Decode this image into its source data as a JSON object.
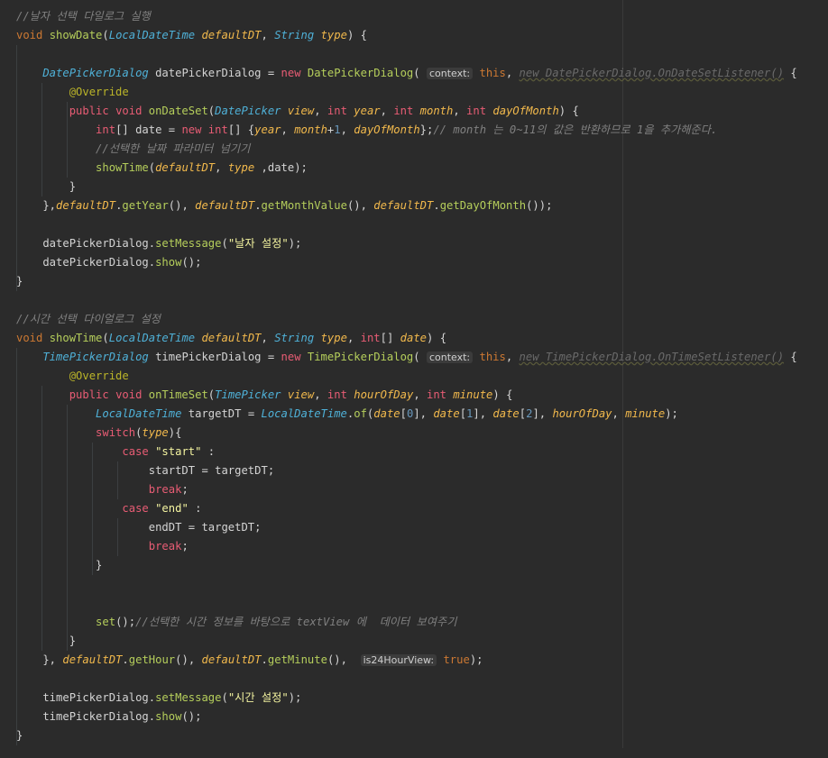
{
  "colors": {
    "background": "#2b2b2b",
    "keyword": "#cc7832",
    "type": "#4fb1d8",
    "function": "#b5ce5b",
    "parameter": "#f2b94c",
    "string": "#f4f4a0",
    "comment": "#808080"
  },
  "lines": [
    [
      [
        "com",
        "//날자 선택 다일로그 실행"
      ]
    ],
    [
      [
        "kw",
        "void "
      ],
      [
        "fn",
        "showDate"
      ],
      [
        "pl",
        "("
      ],
      [
        "typ",
        "LocalDateTime "
      ],
      [
        "param",
        "defaultDT"
      ],
      [
        "pl",
        ", "
      ],
      [
        "typ",
        "String "
      ],
      [
        "param",
        "type"
      ],
      [
        "pl",
        ") {"
      ]
    ],
    [],
    [
      [
        "typ",
        "    DatePickerDialog "
      ],
      [
        "pl",
        "datePickerDialog = "
      ],
      [
        "kw2",
        "new "
      ],
      [
        "fn",
        "DatePickerDialog"
      ],
      [
        "pl",
        "( "
      ],
      [
        "hint",
        "context:"
      ],
      [
        "pl",
        " "
      ],
      [
        "kw",
        "this"
      ],
      [
        "pl",
        ", "
      ],
      [
        "dim",
        "new DatePickerDialog.OnDateSetListener()"
      ],
      [
        "pl",
        " {"
      ]
    ],
    [
      [
        "ann",
        "        @Override"
      ]
    ],
    [
      [
        "kw2",
        "        public "
      ],
      [
        "kw2",
        "void "
      ],
      [
        "fn",
        "onDateSet"
      ],
      [
        "pl",
        "("
      ],
      [
        "typ",
        "DatePicker "
      ],
      [
        "param",
        "view"
      ],
      [
        "pl",
        ", "
      ],
      [
        "kw2",
        "int "
      ],
      [
        "param",
        "year"
      ],
      [
        "pl",
        ", "
      ],
      [
        "kw2",
        "int "
      ],
      [
        "param",
        "month"
      ],
      [
        "pl",
        ", "
      ],
      [
        "kw2",
        "int "
      ],
      [
        "param",
        "dayOfMonth"
      ],
      [
        "pl",
        ") {"
      ]
    ],
    [
      [
        "kw2",
        "            int"
      ],
      [
        "pl",
        "[] date = "
      ],
      [
        "kw2",
        "new "
      ],
      [
        "kw2",
        "int"
      ],
      [
        "pl",
        "[] {"
      ],
      [
        "param",
        "year"
      ],
      [
        "pl",
        ", "
      ],
      [
        "param",
        "month"
      ],
      [
        "pl",
        "+"
      ],
      [
        "num",
        "1"
      ],
      [
        "pl",
        ", "
      ],
      [
        "param",
        "dayOfMonth"
      ],
      [
        "pl",
        "};"
      ],
      [
        "com",
        "// month 는 0~11의 값은 반환하므로 1을 추가해준다."
      ]
    ],
    [
      [
        "com",
        "            //선택한 날짜 파라미터 넘기기"
      ]
    ],
    [
      [
        "fn",
        "            showTime"
      ],
      [
        "pl",
        "("
      ],
      [
        "param",
        "defaultDT"
      ],
      [
        "pl",
        ", "
      ],
      [
        "param",
        "type"
      ],
      [
        "pl",
        " ,date);"
      ]
    ],
    [
      [
        "pl",
        "        }"
      ]
    ],
    [
      [
        "pl",
        "    },"
      ],
      [
        "param",
        "defaultDT"
      ],
      [
        "pl",
        "."
      ],
      [
        "fn",
        "getYear"
      ],
      [
        "pl",
        "(), "
      ],
      [
        "param",
        "defaultDT"
      ],
      [
        "pl",
        "."
      ],
      [
        "fn",
        "getMonthValue"
      ],
      [
        "pl",
        "(), "
      ],
      [
        "param",
        "defaultDT"
      ],
      [
        "pl",
        "."
      ],
      [
        "fn",
        "getDayOfMonth"
      ],
      [
        "pl",
        "());"
      ]
    ],
    [],
    [
      [
        "pl",
        "    datePickerDialog."
      ],
      [
        "fn",
        "setMessage"
      ],
      [
        "pl",
        "("
      ],
      [
        "str",
        "\"날자 설정\""
      ],
      [
        "pl",
        ");"
      ]
    ],
    [
      [
        "pl",
        "    datePickerDialog."
      ],
      [
        "fn",
        "show"
      ],
      [
        "pl",
        "();"
      ]
    ],
    [
      [
        "pl",
        "}"
      ]
    ],
    [],
    [
      [
        "com",
        "//시간 선택 다이얼로그 설정"
      ]
    ],
    [
      [
        "kw",
        "void "
      ],
      [
        "fn",
        "showTime"
      ],
      [
        "pl",
        "("
      ],
      [
        "typ",
        "LocalDateTime "
      ],
      [
        "param",
        "defaultDT"
      ],
      [
        "pl",
        ", "
      ],
      [
        "typ",
        "String "
      ],
      [
        "param",
        "type"
      ],
      [
        "pl",
        ", "
      ],
      [
        "kw2",
        "int"
      ],
      [
        "pl",
        "[] "
      ],
      [
        "param",
        "date"
      ],
      [
        "pl",
        ") {"
      ]
    ],
    [
      [
        "typ",
        "    TimePickerDialog "
      ],
      [
        "pl",
        "timePickerDialog = "
      ],
      [
        "kw2",
        "new "
      ],
      [
        "fn",
        "TimePickerDialog"
      ],
      [
        "pl",
        "( "
      ],
      [
        "hint",
        "context:"
      ],
      [
        "pl",
        " "
      ],
      [
        "kw",
        "this"
      ],
      [
        "pl",
        ", "
      ],
      [
        "dim",
        "new TimePickerDialog.OnTimeSetListener()"
      ],
      [
        "pl",
        " {"
      ]
    ],
    [
      [
        "ann",
        "        @Override"
      ]
    ],
    [
      [
        "kw2",
        "        public "
      ],
      [
        "kw2",
        "void "
      ],
      [
        "fn",
        "onTimeSet"
      ],
      [
        "pl",
        "("
      ],
      [
        "typ",
        "TimePicker "
      ],
      [
        "param",
        "view"
      ],
      [
        "pl",
        ", "
      ],
      [
        "kw2",
        "int "
      ],
      [
        "param",
        "hourOfDay"
      ],
      [
        "pl",
        ", "
      ],
      [
        "kw2",
        "int "
      ],
      [
        "param",
        "minute"
      ],
      [
        "pl",
        ") {"
      ]
    ],
    [
      [
        "typ",
        "            LocalDateTime "
      ],
      [
        "pl",
        "targetDT = "
      ],
      [
        "typ",
        "LocalDateTime"
      ],
      [
        "pl",
        "."
      ],
      [
        "fn",
        "of"
      ],
      [
        "pl",
        "("
      ],
      [
        "param",
        "date"
      ],
      [
        "pl",
        "["
      ],
      [
        "num",
        "0"
      ],
      [
        "pl",
        "], "
      ],
      [
        "param",
        "date"
      ],
      [
        "pl",
        "["
      ],
      [
        "num",
        "1"
      ],
      [
        "pl",
        "], "
      ],
      [
        "param",
        "date"
      ],
      [
        "pl",
        "["
      ],
      [
        "num",
        "2"
      ],
      [
        "pl",
        "], "
      ],
      [
        "param",
        "hourOfDay"
      ],
      [
        "pl",
        ", "
      ],
      [
        "param",
        "minute"
      ],
      [
        "pl",
        ");"
      ]
    ],
    [
      [
        "kw2",
        "            switch"
      ],
      [
        "pl",
        "("
      ],
      [
        "param",
        "type"
      ],
      [
        "pl",
        "){"
      ]
    ],
    [
      [
        "kw2",
        "                case "
      ],
      [
        "str",
        "\"start\""
      ],
      [
        "pl",
        " :"
      ]
    ],
    [
      [
        "pl",
        "                    startDT = targetDT;"
      ]
    ],
    [
      [
        "kw2",
        "                    break"
      ],
      [
        "pl",
        ";"
      ]
    ],
    [
      [
        "kw2",
        "                case "
      ],
      [
        "str",
        "\"end\""
      ],
      [
        "pl",
        " :"
      ]
    ],
    [
      [
        "pl",
        "                    endDT = targetDT;"
      ]
    ],
    [
      [
        "kw2",
        "                    break"
      ],
      [
        "pl",
        ";"
      ]
    ],
    [
      [
        "pl",
        "            }"
      ]
    ],
    [],
    [],
    [
      [
        "fn",
        "            set"
      ],
      [
        "pl",
        "();"
      ],
      [
        "com",
        "//선택한 시간 정보를 바탕으로 textView 에  데이터 보여주기"
      ]
    ],
    [
      [
        "pl",
        "        }"
      ]
    ],
    [
      [
        "pl",
        "    }, "
      ],
      [
        "param",
        "defaultDT"
      ],
      [
        "pl",
        "."
      ],
      [
        "fn",
        "getHour"
      ],
      [
        "pl",
        "(), "
      ],
      [
        "param",
        "defaultDT"
      ],
      [
        "pl",
        "."
      ],
      [
        "fn",
        "getMinute"
      ],
      [
        "pl",
        "(),  "
      ],
      [
        "hint",
        "is24HourView:"
      ],
      [
        "pl",
        " "
      ],
      [
        "kw",
        "true"
      ],
      [
        "pl",
        ");"
      ]
    ],
    [],
    [
      [
        "pl",
        "    timePickerDialog."
      ],
      [
        "fn",
        "setMessage"
      ],
      [
        "pl",
        "("
      ],
      [
        "str",
        "\"시간 설정\""
      ],
      [
        "pl",
        ");"
      ]
    ],
    [
      [
        "pl",
        "    timePickerDialog."
      ],
      [
        "fn",
        "show"
      ],
      [
        "pl",
        "();"
      ]
    ],
    [
      [
        "pl",
        "}"
      ]
    ]
  ]
}
